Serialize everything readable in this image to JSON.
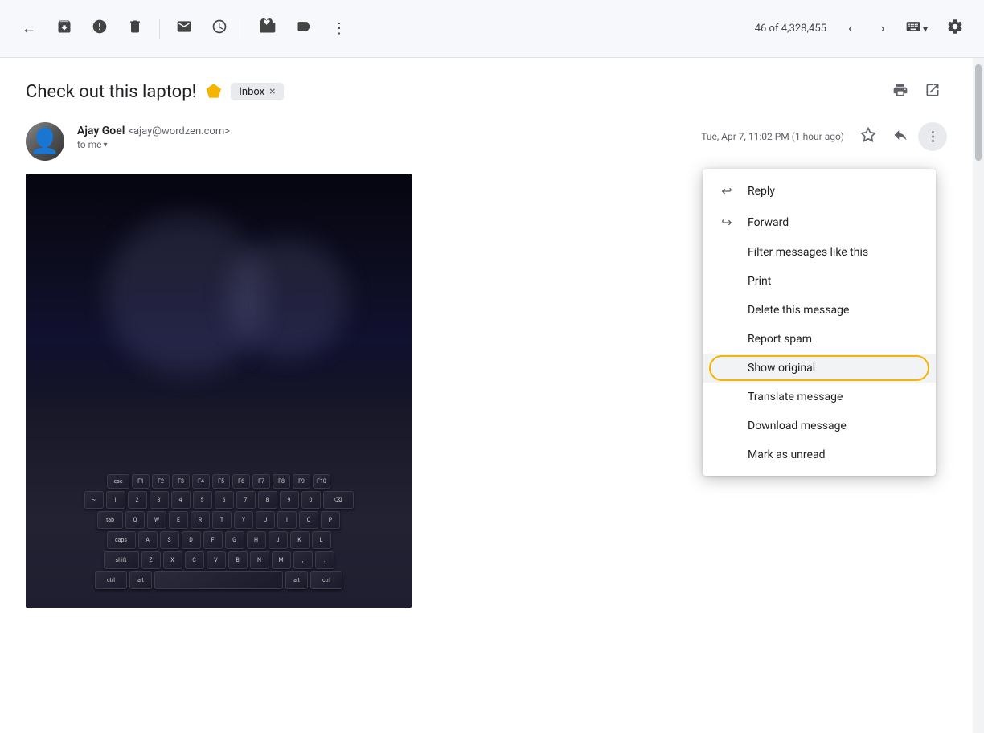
{
  "toolbar": {
    "back_label": "←",
    "archive_label": "⬆",
    "spam_label": "!",
    "delete_label": "🗑",
    "mark_unread_label": "✉",
    "snooze_label": "🕐",
    "move_label": "📥",
    "label_label": "🏷",
    "more_label": "⋮",
    "counter": "46 of 4,328,455",
    "prev_label": "<",
    "next_label": ">",
    "keyboard_label": "⌨",
    "settings_label": "⚙"
  },
  "email": {
    "subject": "Check out this laptop!",
    "inbox_tag": "Inbox",
    "sender_name": "Ajay Goel",
    "sender_email": "<ajay@wordzen.com>",
    "to": "to me",
    "time": "Tue, Apr 7, 11:02 PM (1 hour ago)",
    "print_label": "🖨",
    "open_external_label": "↗"
  },
  "menu": {
    "items": [
      {
        "icon": "↩",
        "label": "Reply",
        "has_icon": true
      },
      {
        "icon": "↪",
        "label": "Forward",
        "has_icon": true
      },
      {
        "icon": "",
        "label": "Filter messages like this",
        "has_icon": false
      },
      {
        "icon": "",
        "label": "Print",
        "has_icon": false
      },
      {
        "icon": "",
        "label": "Delete this message",
        "has_icon": false
      },
      {
        "icon": "",
        "label": "Report spam",
        "has_icon": false
      },
      {
        "icon": "",
        "label": "Show original",
        "has_icon": false,
        "highlighted": true
      },
      {
        "icon": "",
        "label": "Translate message",
        "has_icon": false
      },
      {
        "icon": "",
        "label": "Download message",
        "has_icon": false
      },
      {
        "icon": "",
        "label": "Mark as unread",
        "has_icon": false
      }
    ]
  }
}
